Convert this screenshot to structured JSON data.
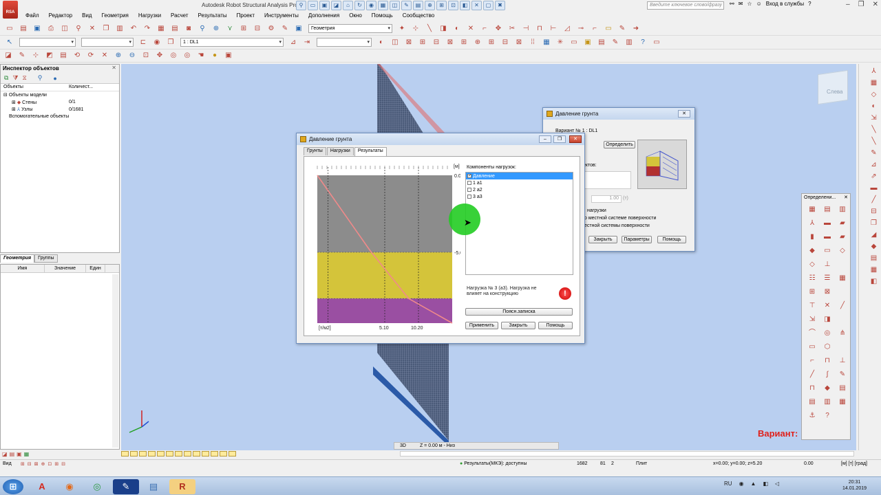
{
  "app": {
    "logo": "RSA PRO",
    "title": "Autodesk Robot Structural Analysis Pro",
    "search_placeholder": "Введите ключевое слово/фразу",
    "login": "Вход в службы"
  },
  "menu": [
    "Файл",
    "Редактор",
    "Вид",
    "Геометрия",
    "Нагрузки",
    "Расчет",
    "Результаты",
    "Проект",
    "Инструменты",
    "Дополнения",
    "Окно",
    "Помощь",
    "Сообщество"
  ],
  "toolbar": {
    "layout_select": "Геометрия",
    "load_case_select": "1 : DL1"
  },
  "inspector": {
    "title": "Инспектор объектов",
    "col_objects": "Объекты",
    "col_count": "Количест...",
    "tree": [
      {
        "label": "Объекты модели",
        "count": ""
      },
      {
        "label": "Стены",
        "count": "0/1"
      },
      {
        "label": "Узлы",
        "count": "0/1681"
      },
      {
        "label": "Вспомогательные объекты",
        "count": ""
      }
    ]
  },
  "left_tabs": {
    "geometry": "Геометрия",
    "groups": "Группы"
  },
  "props": {
    "col_name": "Имя",
    "col_value": "Значение",
    "col_unit": "Един"
  },
  "main_dialog": {
    "title": "Давление грунта",
    "tabs": [
      "Грунты",
      "Нагрузки",
      "Результаты"
    ],
    "components_label": "Компоненты нагрузок:",
    "components": [
      {
        "label": "Давление",
        "checked": true
      },
      {
        "label": "1 a1",
        "checked": false
      },
      {
        "label": "2 a2",
        "checked": false
      },
      {
        "label": "3 a3",
        "checked": false
      }
    ],
    "warning": "Нагрузка № 3 (a3). Нагрузка не влияет на конструкцию",
    "buttons": {
      "report": "Поясн.записка",
      "apply": "Применить",
      "close": "Закрыть",
      "help": "Помощь"
    }
  },
  "chart_data": {
    "type": "area",
    "title": "",
    "xlabel": "[т/м2]",
    "ylabel": "[м]",
    "x_ticks": [
      "[т/м2]",
      "5.10",
      "10.20"
    ],
    "y_ticks": [
      "0.00",
      "-5.00"
    ],
    "xlim": [
      0,
      10.2
    ],
    "ylim": [
      -9.6,
      0
    ],
    "layers": [
      {
        "top": 0,
        "bottom": -5.0,
        "color": "#8c8c8c"
      },
      {
        "top": -5.0,
        "bottom": -8.0,
        "color": "#d4c43a"
      },
      {
        "top": -8.0,
        "bottom": -9.6,
        "color": "#9a4fa2"
      }
    ],
    "pressure_line": {
      "color": "#f08a8a",
      "points": [
        [
          0.0,
          0.0
        ],
        [
          4.0,
          -4.9
        ],
        [
          6.9,
          -8.0
        ],
        [
          10.2,
          -9.6
        ]
      ]
    }
  },
  "bg_dialog": {
    "title": "Давление грунта",
    "variant": "Вариант № 1 : DL1",
    "define_btn": "Определить",
    "objects_label": "ектов:",
    "value": "1.00",
    "unit": "(т)",
    "opt1": "нагрузки",
    "opt2": "о местной системе поверхности",
    "opt3": "естной системы поверхности",
    "buttons": {
      "close": "Закрыть",
      "params": "Параметры",
      "help": "Помощь"
    }
  },
  "def_panel": {
    "title": "Определени..."
  },
  "view": {
    "cube_label": "Слева",
    "variant_label": "Вариант:",
    "mode": "3D",
    "z_info": "Z = 0.00 м - Низ"
  },
  "status": {
    "left": "Вид",
    "results": "Результаты(МКЭ): доступны",
    "n1": "1682",
    "n2": "81",
    "n3": "2",
    "plate": "Плит",
    "coords": "x=0.00; y=0.00; z=5.20",
    "angle": "0.00",
    "units": "[м] [т] [град]"
  },
  "taskbar": {
    "lang": "RU",
    "time": "20:31",
    "date": "14.01.2019"
  },
  "colors": {
    "viewport_bg": "#b9cff0",
    "dialog_title": "#c4d6ee",
    "accent_red": "#e0201a",
    "selection": "#3399ff",
    "cursor_highlight": "#22cc22"
  }
}
